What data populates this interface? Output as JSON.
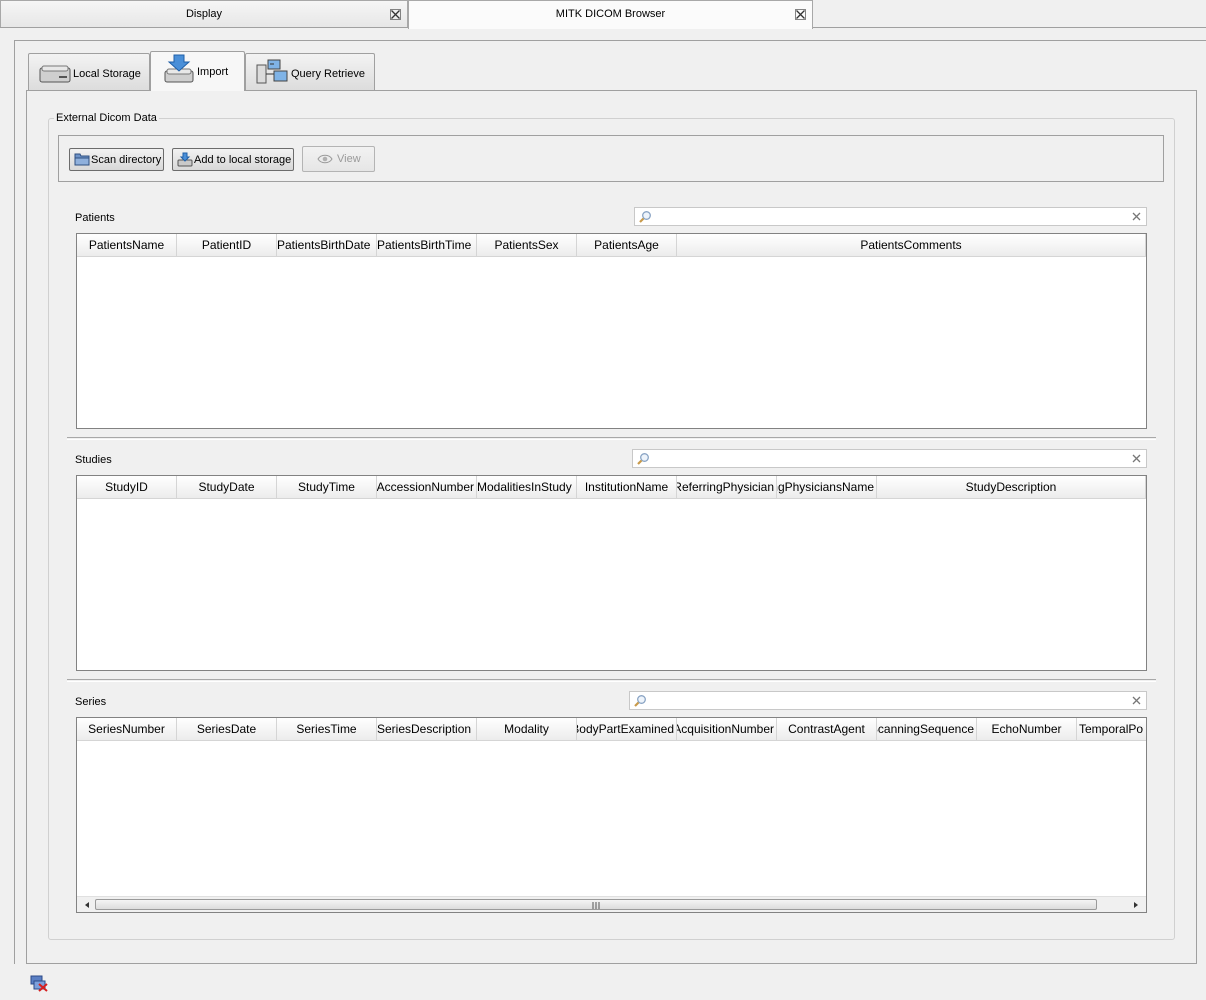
{
  "editor_tabs": [
    {
      "label": "Display",
      "active": false
    },
    {
      "label": "MITK DICOM Browser",
      "active": true
    }
  ],
  "browser_tabs": [
    {
      "label": "Local Storage",
      "icon": "hard-drive-icon",
      "active": false
    },
    {
      "label": "Import",
      "icon": "import-download-icon",
      "active": true
    },
    {
      "label": "Query Retrieve",
      "icon": "network-computers-icon",
      "active": false
    }
  ],
  "import_panel": {
    "group_title": "External Dicom Data",
    "buttons": {
      "scan_directory": "Scan directory",
      "add_to_local_storage": "Add to local storage",
      "view": "View"
    }
  },
  "patients": {
    "label": "Patients",
    "search_value": "",
    "columns": [
      "PatientsName",
      "PatientID",
      "PatientsBirthDate",
      "PatientsBirthTime",
      "PatientsSex",
      "PatientsAge",
      "PatientsComments"
    ],
    "rows": []
  },
  "studies": {
    "label": "Studies",
    "search_value": "",
    "columns": [
      "StudyID",
      "StudyDate",
      "StudyTime",
      "AccessionNumber",
      "ModalitiesInStudy",
      "InstitutionName",
      "ReferringPhysician",
      "PerformingPhysiciansName",
      "StudyDescription"
    ],
    "rows": []
  },
  "series": {
    "label": "Series",
    "search_value": "",
    "columns": [
      "SeriesNumber",
      "SeriesDate",
      "SeriesTime",
      "SeriesDescription",
      "Modality",
      "BodyPartExamined",
      "AcquisitionNumber",
      "ContrastAgent",
      "ScanningSequence",
      "EchoNumber",
      "TemporalPo"
    ],
    "rows": []
  },
  "colors": {
    "background": "#f0f0f0",
    "border": "#a0a0a0",
    "table_bg": "#ffffff"
  }
}
